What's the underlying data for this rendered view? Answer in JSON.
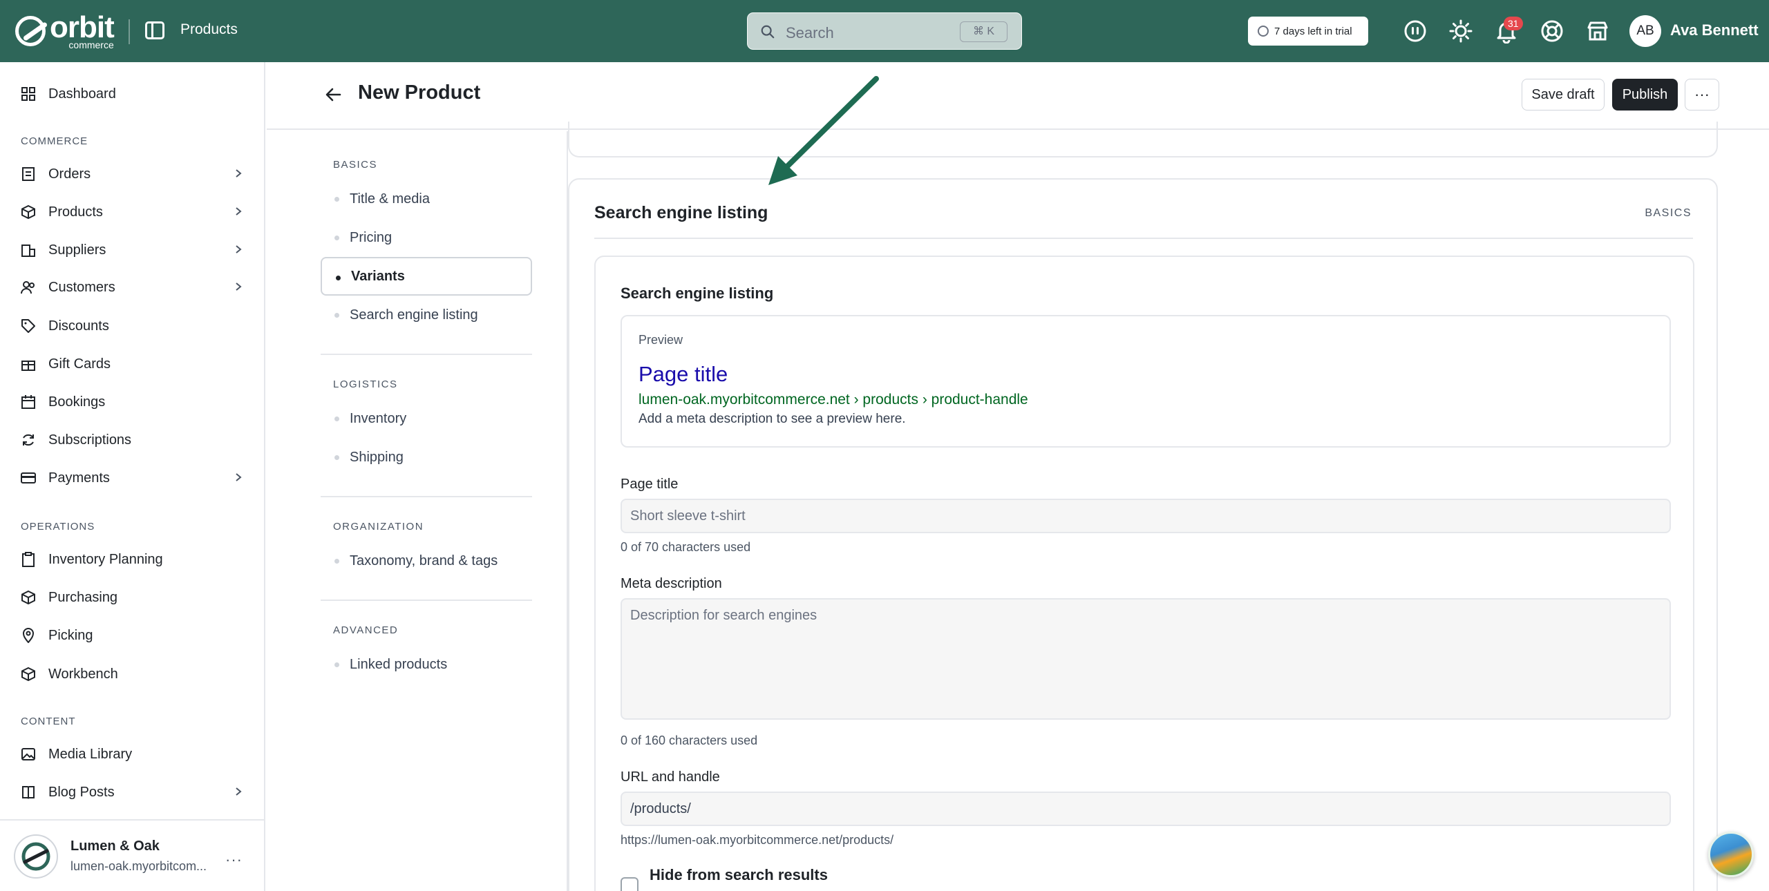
{
  "topbar": {
    "logo_word": "orbit",
    "logo_sub": "commerce",
    "breadcrumb": "Products",
    "search_placeholder": "Search",
    "search_shortcut": "⌘ K",
    "trial_text": "7 days left in trial",
    "notifications_count": "31",
    "user_initials": "AB",
    "user_name": "Ava Bennett",
    "colors": {
      "bar": "#2e6659",
      "badge": "#e5484d"
    }
  },
  "sidebar": {
    "items_top": [
      {
        "label": "Dashboard",
        "icon": "dashboard-icon"
      }
    ],
    "commerce_label": "COMMERCE",
    "commerce_items": [
      {
        "label": "Orders",
        "icon": "orders-icon",
        "chevron": true
      },
      {
        "label": "Products",
        "icon": "products-icon",
        "chevron": true
      },
      {
        "label": "Suppliers",
        "icon": "suppliers-icon",
        "chevron": true
      },
      {
        "label": "Customers",
        "icon": "customers-icon",
        "chevron": true
      },
      {
        "label": "Discounts",
        "icon": "tag-icon",
        "chevron": false
      },
      {
        "label": "Gift Cards",
        "icon": "gift-icon",
        "chevron": false
      },
      {
        "label": "Bookings",
        "icon": "calendar-icon",
        "chevron": false
      },
      {
        "label": "Subscriptions",
        "icon": "refresh-icon",
        "chevron": false
      },
      {
        "label": "Payments",
        "icon": "card-icon",
        "chevron": true
      }
    ],
    "operations_label": "OPERATIONS",
    "operations_items": [
      {
        "label": "Inventory Planning",
        "icon": "clipboard-icon"
      },
      {
        "label": "Purchasing",
        "icon": "box-icon"
      },
      {
        "label": "Picking",
        "icon": "pin-icon"
      },
      {
        "label": "Workbench",
        "icon": "cube-icon"
      }
    ],
    "content_label": "CONTENT",
    "content_items": [
      {
        "label": "Media Library",
        "icon": "image-icon",
        "chevron": false
      },
      {
        "label": "Blog Posts",
        "icon": "book-icon",
        "chevron": true
      }
    ],
    "store": {
      "name": "Lumen & Oak",
      "url": "lumen-oak.myorbitcom..."
    }
  },
  "header": {
    "title": "New Product",
    "save_label": "Save draft",
    "publish_label": "Publish",
    "more_label": "···"
  },
  "secnav": {
    "groups": [
      {
        "label": "BASICS",
        "items": [
          "Title & media",
          "Pricing",
          "Variants",
          "Search engine listing"
        ]
      },
      {
        "label": "LOGISTICS",
        "items": [
          "Inventory",
          "Shipping"
        ]
      },
      {
        "label": "ORGANIZATION",
        "items": [
          "Taxonomy, brand & tags"
        ]
      },
      {
        "label": "ADVANCED",
        "items": [
          "Linked products"
        ]
      }
    ],
    "active": "Variants"
  },
  "main": {
    "card_title": "Search engine listing",
    "card_tag": "BASICS",
    "inner_title": "Search engine listing",
    "preview": {
      "label": "Preview",
      "title": "Page title",
      "url": "lumen-oak.myorbitcommerce.net › products › product-handle",
      "desc": "Add a meta description to see a preview here."
    },
    "page_title": {
      "label": "Page title",
      "placeholder": "Short sleeve t-shirt",
      "help": "0 of 70 characters used"
    },
    "meta": {
      "label": "Meta description",
      "placeholder": "Description for search engines",
      "help": "0 of 160 characters used"
    },
    "url": {
      "label": "URL and handle",
      "value": "/products/",
      "help": "https://lumen-oak.myorbitcommerce.net/products/"
    },
    "hide_label": "Hide from search results"
  },
  "annotation": {
    "arrow_color": "#1e6b52"
  }
}
